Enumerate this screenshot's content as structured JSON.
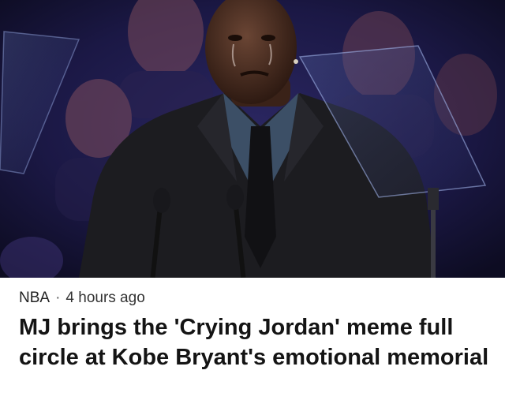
{
  "article": {
    "category": "NBA",
    "separator": "·",
    "time": "4 hours ago",
    "headline": "MJ brings the 'Crying Jordan' meme full circle at Kobe Bryant's emotional memorial"
  },
  "photo": {
    "subject": "man in dark suit crying at podium with microphones",
    "colors": {
      "background": "#15143a",
      "suit": "#1c1c20",
      "shirt": "#3c4f66"
    }
  }
}
